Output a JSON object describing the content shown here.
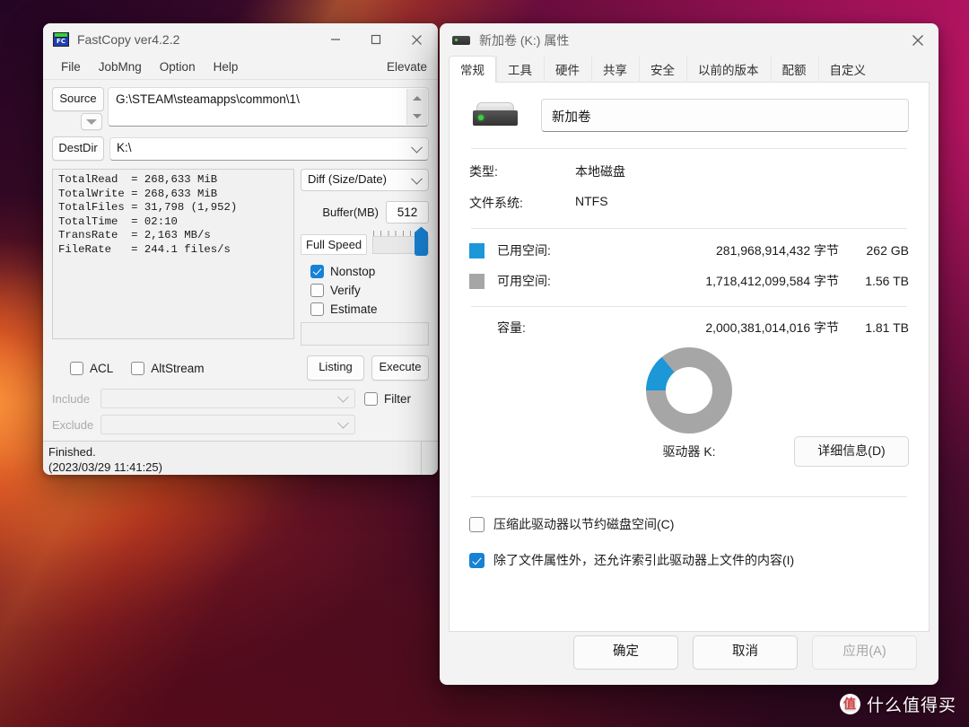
{
  "watermark": {
    "badge": "值",
    "text": "什么值得买"
  },
  "fastcopy": {
    "title": "FastCopy ver4.2.2",
    "icon": "fastcopy-icon",
    "window_buttons": {
      "minimize": "minimize-icon",
      "maximize": "maximize-icon",
      "close": "close-icon"
    },
    "menu": [
      "File",
      "JobMng",
      "Option",
      "Help"
    ],
    "elevate_label": "Elevate",
    "source_label": "Source",
    "source_value": "G:\\STEAM\\steamapps\\common\\1\\",
    "dest_label": "DestDir",
    "dest_value": "K:\\",
    "log_lines": [
      "TotalRead  = 268,633 MiB",
      "TotalWrite = 268,633 MiB",
      "TotalFiles = 31,798 (1,952)",
      "TotalTime  = 02:10",
      "TransRate  = 2,163 MB/s",
      "FileRate   = 244.1 files/s"
    ],
    "mode_value": "Diff (Size/Date)",
    "buffer_label": "Buffer(MB)",
    "buffer_value": "512",
    "speed_label": "Full Speed",
    "checks": [
      {
        "label": "Nonstop",
        "checked": true
      },
      {
        "label": "Verify",
        "checked": false
      },
      {
        "label": "Estimate",
        "checked": false
      }
    ],
    "acl_label": "ACL",
    "acl_checked": false,
    "altstream_label": "AltStream",
    "altstream_checked": false,
    "listing_label": "Listing",
    "execute_label": "Execute",
    "include_label": "Include",
    "include_value": "",
    "exclude_label": "Exclude",
    "exclude_value": "",
    "filter_label": "Filter",
    "filter_checked": false,
    "status_line1": "Finished.",
    "status_line2": "(2023/03/29 11:41:25)"
  },
  "properties": {
    "title": "新加卷 (K:) 属性",
    "close_icon": "close-icon",
    "drive_icon": "hard-drive-icon",
    "tabs": [
      {
        "label": "常规",
        "active": true
      },
      {
        "label": "工具",
        "active": false
      },
      {
        "label": "硬件",
        "active": false
      },
      {
        "label": "共享",
        "active": false
      },
      {
        "label": "安全",
        "active": false
      },
      {
        "label": "以前的版本",
        "active": false
      },
      {
        "label": "配额",
        "active": false
      },
      {
        "label": "自定义",
        "active": false
      }
    ],
    "volume_name": "新加卷",
    "type_label": "类型:",
    "type_value": "本地磁盘",
    "fs_label": "文件系统:",
    "fs_value": "NTFS",
    "used_label": "已用空间:",
    "used_bytes": "281,968,914,432 字节",
    "used_human": "262 GB",
    "free_label": "可用空间:",
    "free_bytes": "1,718,412,099,584 字节",
    "free_human": "1.56 TB",
    "capacity_label": "容量:",
    "capacity_bytes": "2,000,381,014,016 字节",
    "capacity_human": "1.81 TB",
    "drive_caption": "驱动器 K:",
    "details_button": "详细信息(D)",
    "compress_label": "压缩此驱动器以节约磁盘空间(C)",
    "compress_checked": false,
    "index_label": "除了文件属性外，还允许索引此驱动器上文件的内容(I)",
    "index_checked": true,
    "ok_button": "确定",
    "cancel_button": "取消",
    "apply_button": "应用(A)",
    "apply_disabled": true,
    "colors": {
      "used": "#1c97d8",
      "free": "#a6a6a6",
      "accent": "#1782d4"
    }
  },
  "chart_data": {
    "type": "pie",
    "title": "驱动器 K:",
    "categories": [
      "已用空间",
      "可用空间"
    ],
    "values": [
      281968914432,
      1718412099584
    ],
    "percent": [
      14.1,
      85.9
    ],
    "labels": [
      "262 GB",
      "1.56 TB"
    ],
    "colors": [
      "#1c97d8",
      "#a6a6a6"
    ],
    "legend": "left",
    "donut": true
  }
}
